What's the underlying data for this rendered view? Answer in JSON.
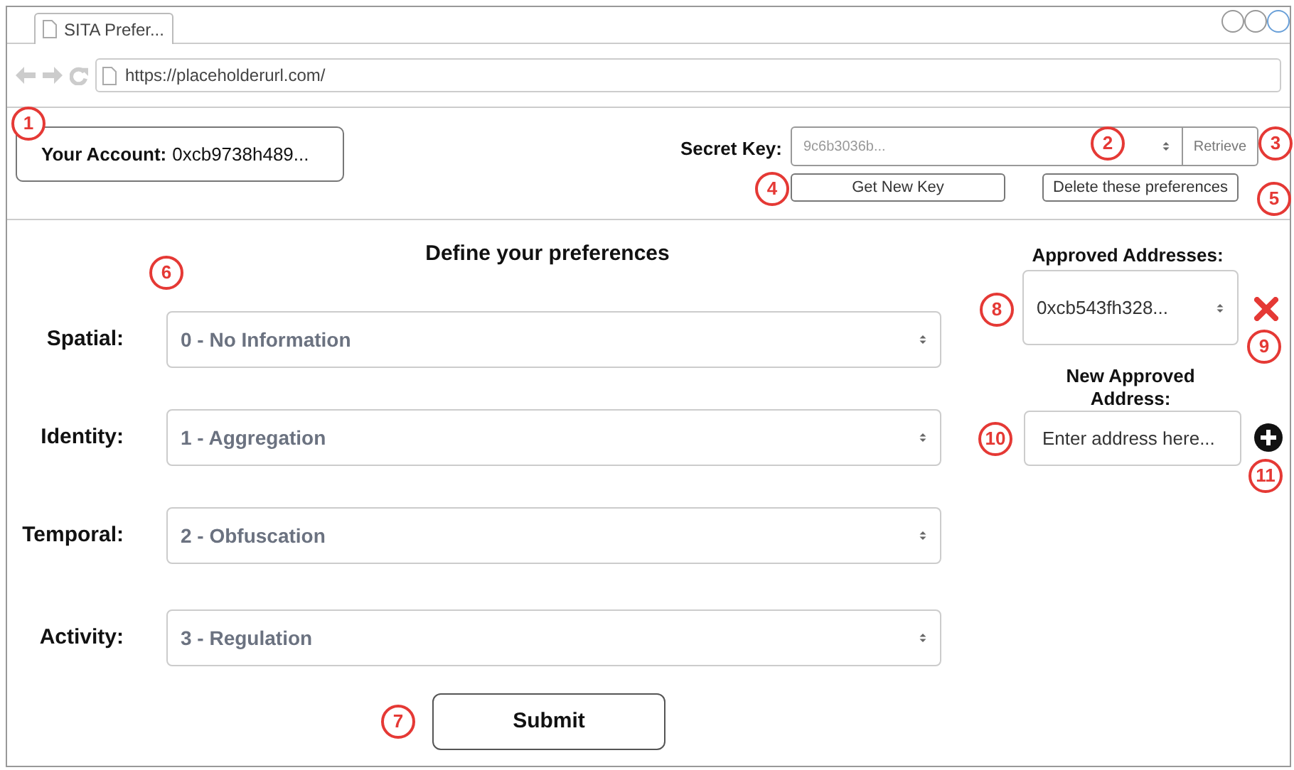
{
  "window": {
    "tab_title": "SITA Prefer...",
    "url": "https://placeholderurl.com/"
  },
  "account": {
    "label": "Your Account:",
    "value": "0xcb9738h489..."
  },
  "secret_key": {
    "label": "Secret Key:",
    "value": "9c6b3036b...",
    "retrieve_button": "Retrieve"
  },
  "key_buttons": [
    "Get New Key",
    "Delete these preferences"
  ],
  "preferences": {
    "title": "Define your preferences",
    "rows": [
      {
        "label": "Spatial:",
        "value": "0 - No Information"
      },
      {
        "label": "Identity:",
        "value": "1 - Aggregation"
      },
      {
        "label": "Temporal:",
        "value": "2 - Obfuscation"
      },
      {
        "label": "Activity:",
        "value": "3 - Regulation"
      }
    ],
    "submit_button": "Submit"
  },
  "approved_addresses": {
    "title": "Approved Addresses:",
    "selected": "0xcb543fh328...",
    "new_title": "New Approved Address:",
    "placeholder": "Enter address here..."
  },
  "callouts": [
    "1",
    "2",
    "3",
    "4",
    "5",
    "6",
    "7",
    "8",
    "9",
    "10",
    "11"
  ]
}
